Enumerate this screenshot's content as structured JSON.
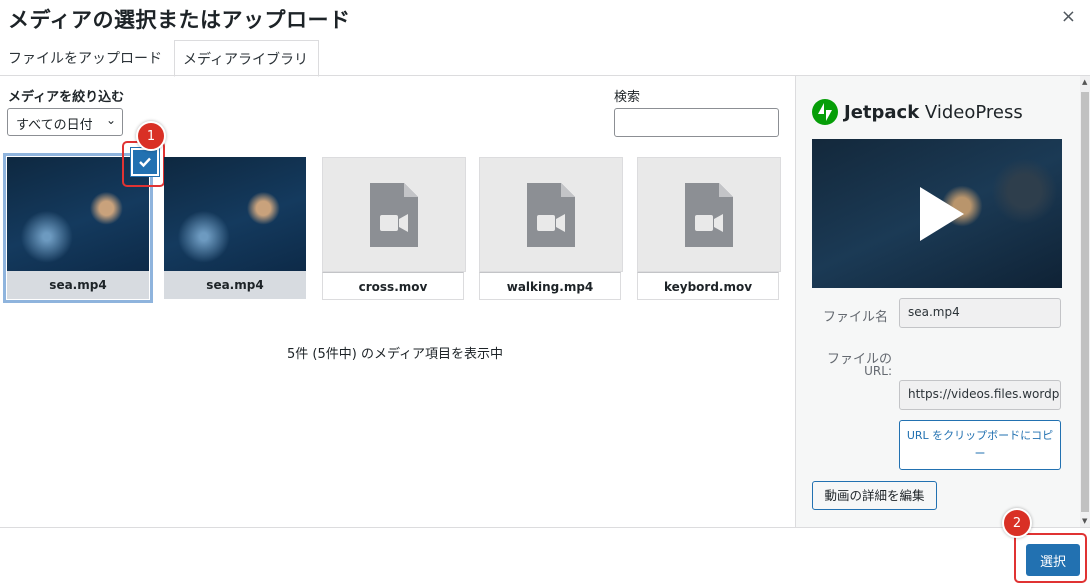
{
  "modal": {
    "title": "メディアの選択またはアップロード",
    "close": "×"
  },
  "tabs": [
    {
      "label": "ファイルをアップロード"
    },
    {
      "label": "メディアライブラリ",
      "active": true
    }
  ],
  "filters": {
    "label": "メディアを絞り込む",
    "date_value": "すべての日付",
    "search_label": "検索",
    "search_value": ""
  },
  "attachments": [
    {
      "name": "sea.mp4",
      "kind": "video-thumbnail",
      "selected": true
    },
    {
      "name": "sea.mp4",
      "kind": "video-thumbnail",
      "selected": false
    },
    {
      "name": "cross.mov",
      "kind": "video-file-icon"
    },
    {
      "name": "walking.mp4",
      "kind": "video-file-icon"
    },
    {
      "name": "keybord.mov",
      "kind": "video-file-icon"
    }
  ],
  "count_text": "5件 (5件中) のメディア項目を表示中",
  "sidebar": {
    "brand_bold": "Jetpack",
    "brand_rest": " VideoPress",
    "filename_label": "ファイル名",
    "filename_value": "sea.mp4",
    "url_label_1": "ファイルの",
    "url_label_2": "URL:",
    "url_value": "https://videos.files.wordp",
    "copy_button": "URL をクリップボードにコピー",
    "edit_button": "動画の詳細を編集"
  },
  "footer": {
    "select_button": "選択"
  },
  "callouts": [
    "1",
    "2"
  ],
  "colors": {
    "accent": "#2271b1",
    "callout": "#d93025",
    "jetpack_green": "#069e08"
  }
}
